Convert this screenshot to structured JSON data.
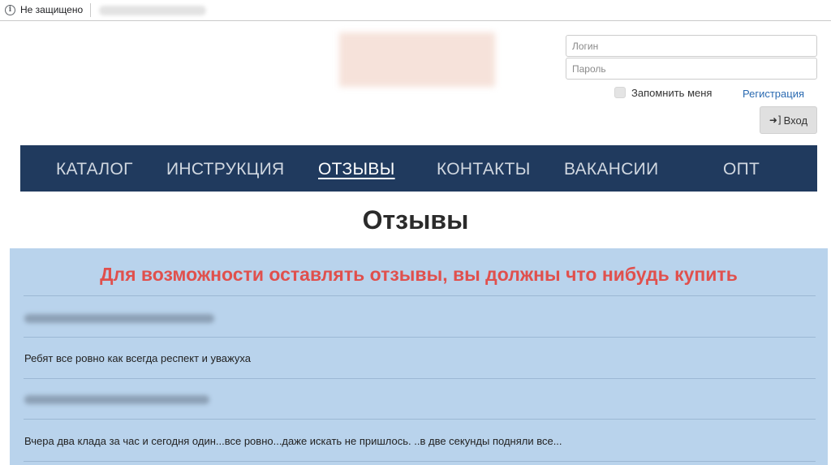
{
  "browser": {
    "security_status": "Не защищено",
    "info_icon": "info-icon"
  },
  "auth": {
    "login_placeholder": "Логин",
    "password_placeholder": "Пароль",
    "remember_label": "Запомнить меня",
    "register_link": "Регистрация",
    "login_button": "Вход",
    "login_icon": "sign-in-icon"
  },
  "nav": {
    "items": [
      {
        "label": "КАТАЛОГ"
      },
      {
        "label": "ИНСТРУКЦИЯ"
      },
      {
        "label": "ОТЗЫВЫ",
        "active": true
      },
      {
        "label": "КОНТАКТЫ"
      },
      {
        "label": "ВАКАНСИИ"
      },
      {
        "label": "ОПТ"
      }
    ]
  },
  "page": {
    "title": "Отзывы",
    "notice": "Для возможности оставлять отзывы, вы должны что нибудь купить"
  },
  "reviews": [
    {
      "text": "Ребят все ровно как всегда респект и уважуха"
    },
    {
      "text": "Вчера два клада за час и сегодня один...все ровно...даже искать не пришлось. ..в две секунды подняли все..."
    }
  ],
  "colors": {
    "nav_background": "#203a5e",
    "panel_background": "#b9d3ec",
    "notice_text": "#e0504d",
    "link": "#2a6ab1"
  }
}
